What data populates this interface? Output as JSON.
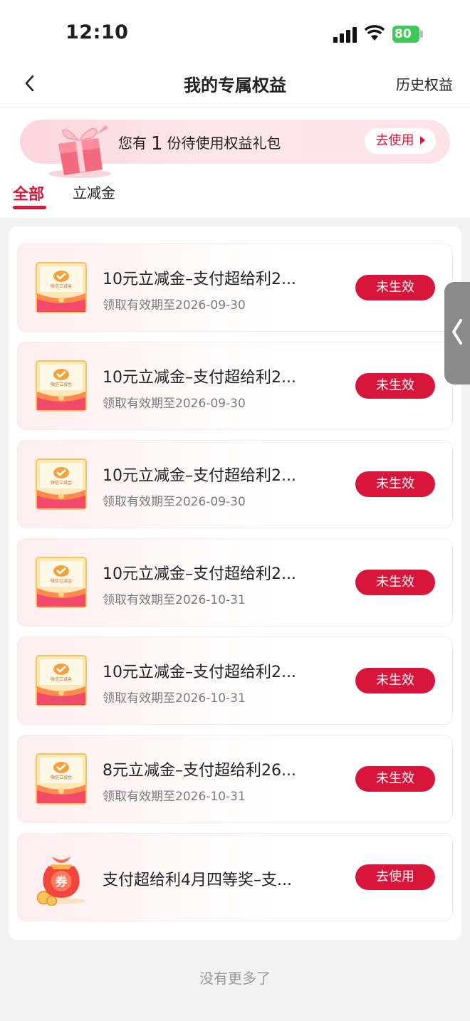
{
  "status_bar": {
    "time": "12:10",
    "battery": "80"
  },
  "nav": {
    "title": "我的专属权益",
    "history": "历史权益"
  },
  "gift_banner": {
    "text_before": "您有",
    "count": "1",
    "text_after": "份待使用权益礼包",
    "button": "去使用"
  },
  "tabs": [
    {
      "label": "全部",
      "active": true
    },
    {
      "label": "立减金",
      "active": false
    }
  ],
  "thumb_label": "·微信立减金·",
  "items": [
    {
      "title": "10元立减金–支付超给利2...",
      "date": "领取有效期至2026-09-30",
      "button": "未生效",
      "icon": "wechat-voucher-icon"
    },
    {
      "title": "10元立减金–支付超给利2...",
      "date": "领取有效期至2026-09-30",
      "button": "未生效",
      "icon": "wechat-voucher-icon"
    },
    {
      "title": "10元立减金–支付超给利2...",
      "date": "领取有效期至2026-09-30",
      "button": "未生效",
      "icon": "wechat-voucher-icon"
    },
    {
      "title": "10元立减金–支付超给利2...",
      "date": "领取有效期至2026-10-31",
      "button": "未生效",
      "icon": "wechat-voucher-icon"
    },
    {
      "title": "10元立减金–支付超给利2...",
      "date": "领取有效期至2026-10-31",
      "button": "未生效",
      "icon": "wechat-voucher-icon"
    },
    {
      "title": "8元立减金–支付超给利26...",
      "date": "领取有效期至2026-10-31",
      "button": "未生效",
      "icon": "wechat-voucher-icon"
    },
    {
      "title": "支付超给利4月四等奖–支...",
      "date": "",
      "button": "去使用",
      "icon": "coupon-bag-icon",
      "bag_label": "券"
    }
  ],
  "footer": "没有更多了",
  "colors": {
    "accent": "#d8163c",
    "battery": "#3ec95a"
  }
}
